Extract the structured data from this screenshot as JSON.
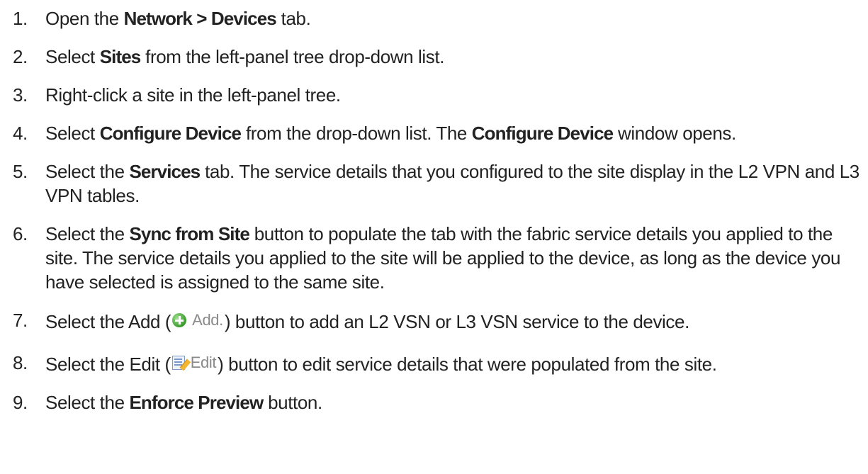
{
  "steps": [
    {
      "num": "1.",
      "parts": [
        {
          "t": "Open the ",
          "b": false
        },
        {
          "t": "Network > Devices",
          "b": true
        },
        {
          "t": " tab.",
          "b": false
        }
      ]
    },
    {
      "num": "2.",
      "parts": [
        {
          "t": "Select ",
          "b": false
        },
        {
          "t": "Sites",
          "b": true
        },
        {
          "t": " from the left-panel tree drop-down list.",
          "b": false
        }
      ]
    },
    {
      "num": "3.",
      "parts": [
        {
          "t": "Right-click a site in the left-panel tree.",
          "b": false
        }
      ]
    },
    {
      "num": "4.",
      "parts": [
        {
          "t": "Select ",
          "b": false
        },
        {
          "t": "Configure Device",
          "b": true
        },
        {
          "t": " from the drop-down list. The ",
          "b": false
        },
        {
          "t": "Configure Device",
          "b": true
        },
        {
          "t": " window opens.",
          "b": false
        }
      ]
    },
    {
      "num": "5.",
      "parts": [
        {
          "t": "Select the ",
          "b": false
        },
        {
          "t": "Services",
          "b": true
        },
        {
          "t": " tab. The service details that you configured to the site display in the L2 VPN and L3 VPN tables.",
          "b": false
        }
      ]
    },
    {
      "num": "6.",
      "parts": [
        {
          "t": "Select the ",
          "b": false
        },
        {
          "t": "Sync from Site",
          "b": true
        },
        {
          "t": " button to populate the tab with the fabric service details you applied to the site. The service details you applied to the site will be applied to the device, as long as the device you have selected is assigned to the same site.",
          "b": false
        }
      ]
    },
    {
      "num": "7.",
      "parts": [
        {
          "t": "Select the Add (",
          "b": false
        },
        {
          "btn": "add",
          "label": "Add."
        },
        {
          "t": ") button to add an L2 VSN or L3 VSN service to the device.",
          "b": false
        }
      ]
    },
    {
      "num": "8.",
      "parts": [
        {
          "t": "Select the Edit (",
          "b": false
        },
        {
          "btn": "edit",
          "label": "Edit"
        },
        {
          "t": ") button to edit service details that were populated from the site.",
          "b": false
        }
      ]
    },
    {
      "num": "9.",
      "parts": [
        {
          "t": "Select the ",
          "b": false
        },
        {
          "t": "Enforce Preview",
          "b": true
        },
        {
          "t": " button.",
          "b": false
        }
      ]
    }
  ]
}
